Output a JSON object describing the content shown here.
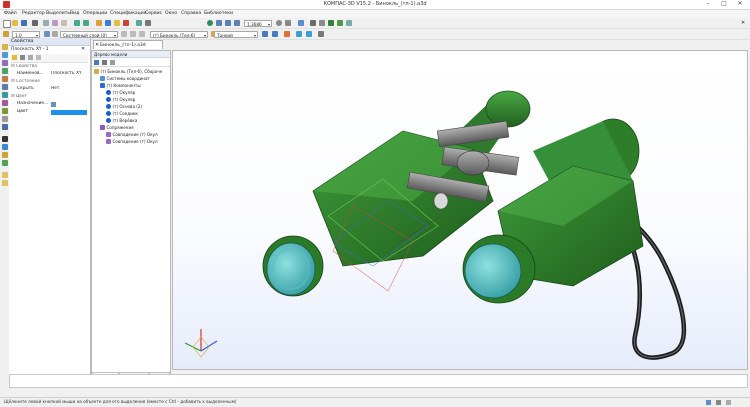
{
  "window": {
    "title": "КОМПАС-3D V15.2 - Бинокль_(тл-1).a3d",
    "buttons": [
      "–",
      "□",
      "✕"
    ]
  },
  "menu": [
    "Файл",
    "Редактор",
    "Выделить",
    "Вид",
    "Операции",
    "Спецификация",
    "Сервис",
    "Окно",
    "Справка",
    "Библиотеки"
  ],
  "toolbar1": {
    "zoom_value": "1.3686"
  },
  "toolbar2": {
    "scale_value": "1.0",
    "cs_value": "Системный слой (0)",
    "component_value": "(т) Бинокль (Тел-6)",
    "style_value": "Тонкий"
  },
  "properties": {
    "title": "Свойства",
    "object_title": "Плоскость XY - 1",
    "sections": [
      {
        "type": "section",
        "label": "Свойства"
      },
      {
        "type": "row",
        "label": "Наименов...",
        "value": "Плоскость XY"
      },
      {
        "type": "section",
        "label": "Состояние"
      },
      {
        "type": "row",
        "label": "Скрыть",
        "value": "Нет"
      },
      {
        "type": "section",
        "label": "Цвет"
      },
      {
        "type": "row",
        "label": "Назначение...",
        "value": ""
      },
      {
        "type": "row",
        "label": "Цвет",
        "value": ""
      }
    ],
    "accent_color": "#1e90e8"
  },
  "document_tab": {
    "label": "Бинокль_(тл-1).a3d"
  },
  "tree": {
    "title": "Дерево модели",
    "items": [
      {
        "indent": 0,
        "icon": "assembly-icon",
        "label": "(т) Бинокль (Тел-6), Сборочн"
      },
      {
        "indent": 1,
        "icon": "coordinate-systems-icon",
        "label": "Системы координат"
      },
      {
        "indent": 1,
        "icon": "components-icon",
        "label": "(т) Компоненты"
      },
      {
        "indent": 2,
        "icon": "part-icon",
        "label": "(т) Окуляр"
      },
      {
        "indent": 2,
        "icon": "part-icon",
        "label": "(т) Окуляр"
      },
      {
        "indent": 2,
        "icon": "part-icon",
        "label": "(т) Основа (2)"
      },
      {
        "indent": 2,
        "icon": "part-icon",
        "label": "(т) Соединк"
      },
      {
        "indent": 2,
        "icon": "part-icon",
        "label": "(т) Верёвка"
      },
      {
        "indent": 1,
        "icon": "mates-icon",
        "label": "Сопряжения"
      },
      {
        "indent": 2,
        "icon": "mate-icon",
        "label": "Совпадение (т) Окул"
      },
      {
        "indent": 2,
        "icon": "mate-icon",
        "label": "Совпадение (т) Окул"
      }
    ],
    "bottom_tabs": [
      "Построение",
      "Исполнения",
      "Зоны"
    ]
  },
  "status": {
    "text": "Щёлкните левой кнопкой мыши на объекте для его выделения (вместе с Ctrl - добавить к выделенным)"
  },
  "colors": {
    "model_green": "#2e7d32",
    "lens_cyan": "#4fc3c7",
    "highlight_blue": "#1e90e8"
  }
}
